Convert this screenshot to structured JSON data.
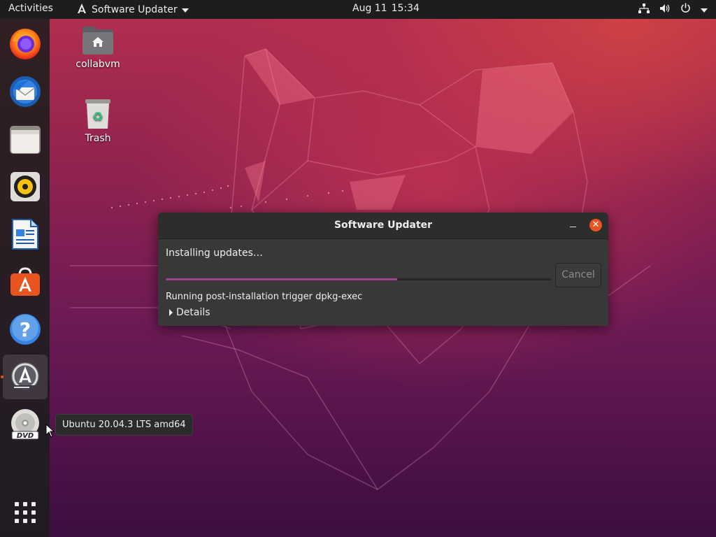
{
  "topbar": {
    "activities_label": "Activities",
    "app_menu_label": "Software Updater",
    "date": "Aug 11",
    "time": "15:34",
    "tray_icons": [
      "network-icon",
      "volume-icon",
      "power-icon"
    ]
  },
  "dock": {
    "items": [
      {
        "name": "firefox",
        "icon": "firefox-icon"
      },
      {
        "name": "thunderbird",
        "icon": "thunderbird-icon"
      },
      {
        "name": "files",
        "icon": "files-icon"
      },
      {
        "name": "rhythmbox",
        "icon": "rhythmbox-icon"
      },
      {
        "name": "libreoffice-writer",
        "icon": "writer-icon"
      },
      {
        "name": "ubuntu-software",
        "icon": "software-icon"
      },
      {
        "name": "help",
        "icon": "help-icon"
      },
      {
        "name": "software-updater",
        "icon": "updater-icon",
        "running": true
      },
      {
        "name": "dvd",
        "icon": "dvd-icon"
      },
      {
        "name": "show-applications",
        "icon": "app-grid-icon"
      }
    ]
  },
  "desktop": {
    "icons": [
      {
        "label": "collabvm",
        "icon": "home-folder-icon"
      },
      {
        "label": "Trash",
        "icon": "trash-icon"
      }
    ]
  },
  "dialog": {
    "title": "Software Updater",
    "status": "Installing updates…",
    "progress": 0.6,
    "cancel_label": "Cancel",
    "subtask": "Running post-installation trigger dpkg-exec",
    "details_label": "Details"
  },
  "tooltip": {
    "text": "Ubuntu 20.04.3 LTS amd64"
  },
  "colors": {
    "accent": "#e95420",
    "progress": "#a4418f",
    "topbar_bg": "#1d1d1d",
    "dialog_bg": "#383838"
  }
}
